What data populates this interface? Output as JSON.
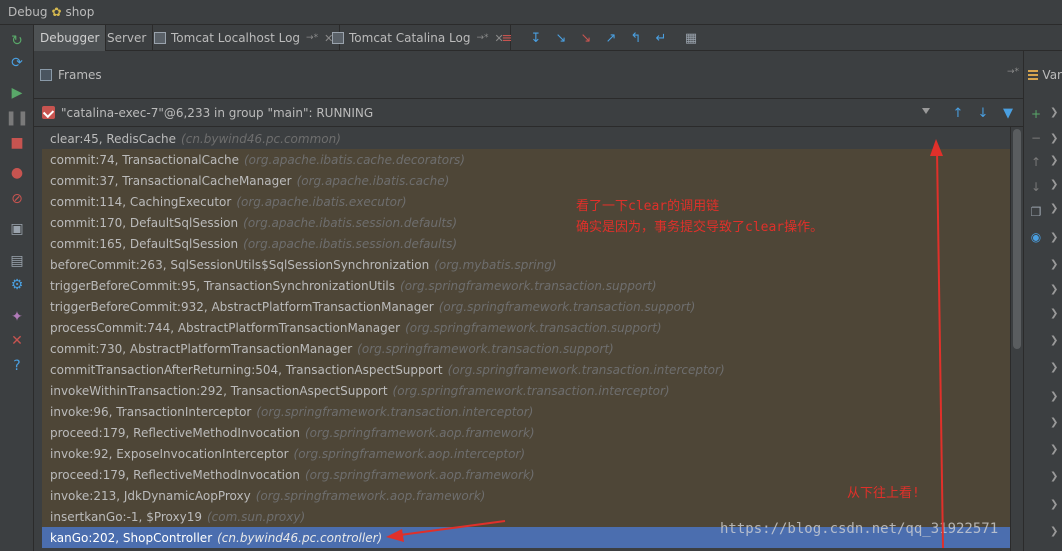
{
  "title": {
    "prefix": "Debug",
    "project": "shop"
  },
  "tabs": [
    {
      "label": "Debugger",
      "active": true,
      "has_icon": false,
      "pinned": false,
      "closable": false
    },
    {
      "label": "Server",
      "active": false,
      "has_icon": false,
      "pinned": false,
      "closable": false
    },
    {
      "label": "Tomcat Localhost Log",
      "active": false,
      "has_icon": true,
      "pinned": true,
      "closable": true
    },
    {
      "label": "Tomcat Catalina Log",
      "active": false,
      "has_icon": true,
      "pinned": true,
      "closable": true
    }
  ],
  "step_toolbar": {
    "icons": [
      "show-execution-point-icon",
      "step-over-icon",
      "step-into-icon",
      "force-step-into-icon",
      "step-out-icon",
      "drop-frame-icon",
      "run-to-cursor-icon",
      "evaluate-expression-icon"
    ]
  },
  "frames_panel": {
    "title": "Frames",
    "pin": "→*"
  },
  "variables_panel": {
    "title": "Var"
  },
  "thread": {
    "label": "\"catalina-exec-7\"@6,233 in group \"main\": RUNNING"
  },
  "frames": [
    {
      "method": "clear:45, RedisCache",
      "pkg": "(cn.bywind46.pc.common)",
      "kind": "first"
    },
    {
      "method": "commit:74, TransactionalCache",
      "pkg": "(org.apache.ibatis.cache.decorators)",
      "kind": "lib"
    },
    {
      "method": "commit:37, TransactionalCacheManager",
      "pkg": "(org.apache.ibatis.cache)",
      "kind": "lib"
    },
    {
      "method": "commit:114, CachingExecutor",
      "pkg": "(org.apache.ibatis.executor)",
      "kind": "lib"
    },
    {
      "method": "commit:170, DefaultSqlSession",
      "pkg": "(org.apache.ibatis.session.defaults)",
      "kind": "lib"
    },
    {
      "method": "commit:165, DefaultSqlSession",
      "pkg": "(org.apache.ibatis.session.defaults)",
      "kind": "lib"
    },
    {
      "method": "beforeCommit:263, SqlSessionUtils$SqlSessionSynchronization",
      "pkg": "(org.mybatis.spring)",
      "kind": "lib"
    },
    {
      "method": "triggerBeforeCommit:95, TransactionSynchronizationUtils",
      "pkg": "(org.springframework.transaction.support)",
      "kind": "lib"
    },
    {
      "method": "triggerBeforeCommit:932, AbstractPlatformTransactionManager",
      "pkg": "(org.springframework.transaction.support)",
      "kind": "lib"
    },
    {
      "method": "processCommit:744, AbstractPlatformTransactionManager",
      "pkg": "(org.springframework.transaction.support)",
      "kind": "lib"
    },
    {
      "method": "commit:730, AbstractPlatformTransactionManager",
      "pkg": "(org.springframework.transaction.support)",
      "kind": "lib"
    },
    {
      "method": "commitTransactionAfterReturning:504, TransactionAspectSupport",
      "pkg": "(org.springframework.transaction.interceptor)",
      "kind": "lib"
    },
    {
      "method": "invokeWithinTransaction:292, TransactionAspectSupport",
      "pkg": "(org.springframework.transaction.interceptor)",
      "kind": "lib"
    },
    {
      "method": "invoke:96, TransactionInterceptor",
      "pkg": "(org.springframework.transaction.interceptor)",
      "kind": "lib"
    },
    {
      "method": "proceed:179, ReflectiveMethodInvocation",
      "pkg": "(org.springframework.aop.framework)",
      "kind": "lib"
    },
    {
      "method": "invoke:92, ExposeInvocationInterceptor",
      "pkg": "(org.springframework.aop.interceptor)",
      "kind": "lib"
    },
    {
      "method": "proceed:179, ReflectiveMethodInvocation",
      "pkg": "(org.springframework.aop.framework)",
      "kind": "lib"
    },
    {
      "method": "invoke:213, JdkDynamicAopProxy",
      "pkg": "(org.springframework.aop.framework)",
      "kind": "lib"
    },
    {
      "method": "insertkanGo:-1, $Proxy19",
      "pkg": "(com.sun.proxy)",
      "kind": "lib"
    },
    {
      "method": "kanGo:202, ShopController",
      "pkg": "(cn.bywind46.pc.controller)",
      "kind": "sel"
    }
  ],
  "annotations": {
    "note_line1": "看了一下clear的调用链",
    "note_line2": "确实是因为，事务提交导致了clear操作。",
    "bottom_note": "从下往上看!",
    "watermark": "https://blog.csdn.net/qq_31922571"
  },
  "colors": {
    "annotation_red": "#e0302a",
    "selection_blue": "#4b6eaf",
    "library_frame_bg": "#4e4637"
  }
}
